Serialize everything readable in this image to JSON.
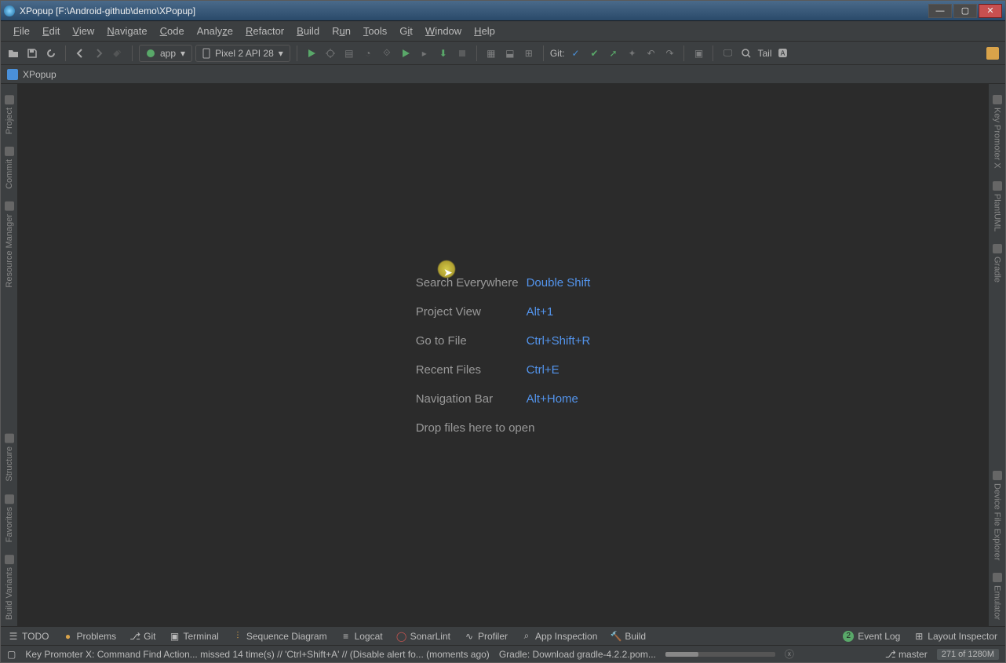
{
  "window": {
    "title": "XPopup [F:\\Android-github\\demo\\XPopup]",
    "min": "—",
    "max": "▢",
    "close": "✕"
  },
  "menu": [
    "File",
    "Edit",
    "View",
    "Navigate",
    "Code",
    "Analyze",
    "Refactor",
    "Build",
    "Run",
    "Tools",
    "Git",
    "Window",
    "Help"
  ],
  "toolbar": {
    "config": "app",
    "device": "Pixel 2 API 28",
    "git_label": "Git:",
    "tail_label": "Tail"
  },
  "nav": {
    "project": "XPopup"
  },
  "left_side": [
    "Project",
    "Commit",
    "Resource Manager",
    "Structure",
    "Favorites",
    "Build Variants"
  ],
  "right_side": [
    "Key Promoter X",
    "PlantUML",
    "Gradle",
    "Device File Explorer",
    "Emulator"
  ],
  "hints": [
    {
      "label": "Search Everywhere",
      "shortcut": "Double Shift"
    },
    {
      "label": "Project View",
      "shortcut": "Alt+1"
    },
    {
      "label": "Go to File",
      "shortcut": "Ctrl+Shift+R"
    },
    {
      "label": "Recent Files",
      "shortcut": "Ctrl+E"
    },
    {
      "label": "Navigation Bar",
      "shortcut": "Alt+Home"
    }
  ],
  "drop_hint": "Drop files here to open",
  "bottom": {
    "todo": "TODO",
    "problems": "Problems",
    "git": "Git",
    "terminal": "Terminal",
    "sequence": "Sequence Diagram",
    "logcat": "Logcat",
    "sonar": "SonarLint",
    "profiler": "Profiler",
    "appinsp": "App Inspection",
    "build": "Build",
    "eventlog": "Event Log",
    "event_count": "2",
    "layoutinsp": "Layout Inspector"
  },
  "status": {
    "msg": "Key Promoter X: Command Find Action... missed 14 time(s) // 'Ctrl+Shift+A' // (Disable alert fo... (moments ago)",
    "gradle": "Gradle: Download gradle-4.2.2.pom...",
    "branch": "master",
    "memory": "271 of 1280M"
  }
}
